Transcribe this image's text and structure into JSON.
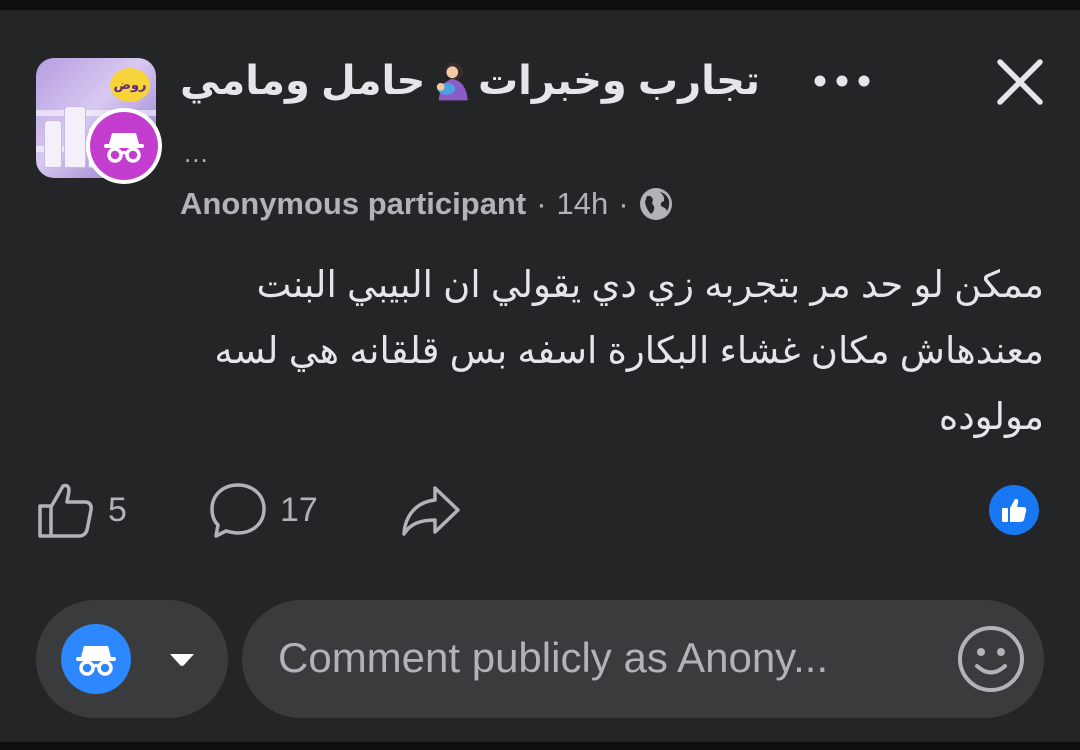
{
  "header": {
    "group_name_part1": "تجارب وخبرات",
    "group_name_part2": "حامل ومامي",
    "group_name_emoji": "breastfeeding-mother-icon",
    "avatar_badge_text": "روض",
    "ellipsis": "..."
  },
  "meta": {
    "author": "Anonymous participant",
    "separator": "·",
    "time": "14h",
    "audience_icon": "globe-icon"
  },
  "post": {
    "text": "ممكن لو حد مر بتجربه زي دي يقولي ان البيبي البنت معندهاش مكان غشاء البكارة اسفه بس قلقانه هي لسه مولوده"
  },
  "actions": {
    "like_count": "5",
    "comment_count": "17",
    "share_icon": "share-icon"
  },
  "reactions": {
    "type": "like"
  },
  "comment_bar": {
    "identity_icon": "anonymous-icon",
    "placeholder": "Comment publicly as Anony..."
  },
  "colors": {
    "background": "#242526",
    "input_bg": "#3a3b3c",
    "primary_text": "#e4e6eb",
    "secondary_text": "#b0b3b8",
    "accent_blue": "#1877f2",
    "anon_magenta": "#c33ecf"
  }
}
